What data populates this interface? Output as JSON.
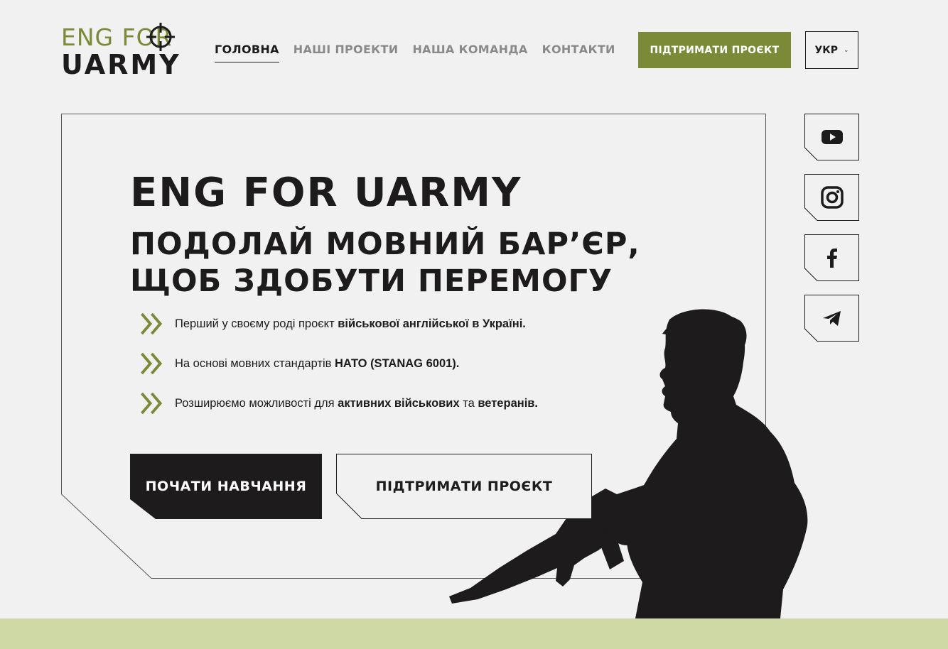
{
  "logo": {
    "line1": "ENG FOR",
    "line2": "UARMY"
  },
  "nav": {
    "items": [
      {
        "label": "ГОЛОВНА",
        "active": true
      },
      {
        "label": "НАШІ ПРОЕКТИ",
        "active": false
      },
      {
        "label": "НАША КОМАНДА",
        "active": false
      },
      {
        "label": "КОНТАКТИ",
        "active": false
      }
    ]
  },
  "header": {
    "support_label": "ПІДТРИМАТИ ПРОЄКТ",
    "language": {
      "selected": "УКР",
      "icon": "chevron-down-icon"
    }
  },
  "hero": {
    "title": "ENG FOR UARMY",
    "subtitle_line1": "ПОДОЛАЙ МОВНИЙ БАР’ЄР,",
    "subtitle_line2": "ЩОБ ЗДОБУТИ ПЕРЕМОГУ",
    "bullets": [
      {
        "parts": [
          {
            "text": "Перший у своєму роді проєкт ",
            "bold": false
          },
          {
            "text": "військової англійської в Україні.",
            "bold": true
          }
        ]
      },
      {
        "parts": [
          {
            "text": "На основі мовних стандартів ",
            "bold": false
          },
          {
            "text": "НАТО (STANAG 6001).",
            "bold": true
          }
        ]
      },
      {
        "parts": [
          {
            "text": "Розширюємо можливості для ",
            "bold": false
          },
          {
            "text": "активних військових",
            "bold": true
          },
          {
            "text": " та ",
            "bold": false
          },
          {
            "text": "ветеранів.",
            "bold": true
          }
        ]
      }
    ],
    "start_button": "ПОЧАТИ НАВЧАННЯ",
    "support_button": "ПІДТРИМАТИ ПРОЄКТ"
  },
  "social": [
    {
      "name": "youtube",
      "icon": "youtube-icon"
    },
    {
      "name": "instagram",
      "icon": "instagram-icon"
    },
    {
      "name": "facebook",
      "icon": "facebook-icon"
    },
    {
      "name": "telegram",
      "icon": "telegram-icon"
    }
  ],
  "colors": {
    "accent": "#7a8a37",
    "dark": "#1d1b1c",
    "background": "#f1f1f1",
    "band": "#cfd9a5"
  }
}
